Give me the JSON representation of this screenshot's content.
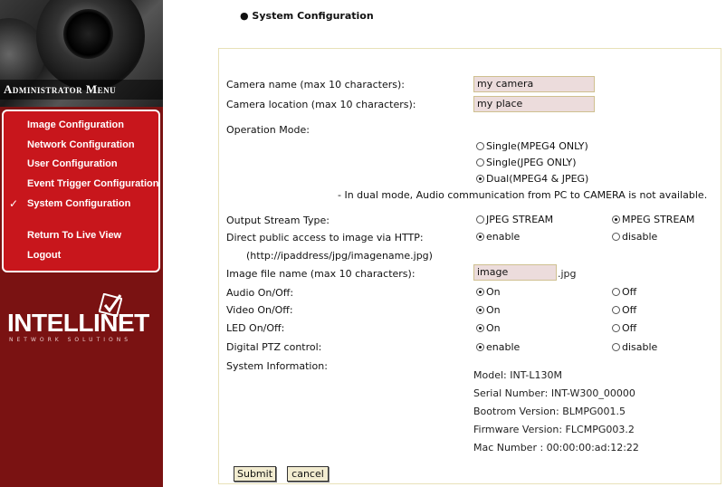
{
  "sidebar": {
    "title": "Administrator Menu",
    "items": [
      {
        "label": "Image Configuration"
      },
      {
        "label": "Network Configuration"
      },
      {
        "label": "User Configuration"
      },
      {
        "label": "Event Trigger Configuration"
      },
      {
        "label": "System Configuration",
        "active": true
      },
      {
        "label": "Return To Live View"
      },
      {
        "label": "Logout"
      }
    ],
    "logo": {
      "brand": "INTELLINET",
      "tagline": "NETWORK SOLUTIONS"
    }
  },
  "page": {
    "heading": "● System Configuration"
  },
  "form": {
    "camera_name": {
      "label": "Camera name (max 10 characters):",
      "value": "my camera"
    },
    "camera_location": {
      "label": "Camera location (max 10 characters):",
      "value": "my place"
    },
    "operation_mode": {
      "label": "Operation Mode:",
      "options": [
        "Single(MPEG4 ONLY)",
        "Single(JPEG ONLY)",
        "Dual(MPEG4 & JPEG)"
      ],
      "selected": "Dual(MPEG4 & JPEG)",
      "note": "- In dual mode, Audio communication from PC to CAMERA is not available."
    },
    "output_stream": {
      "label": "Output Stream Type:",
      "options": [
        "JPEG STREAM",
        "MPEG STREAM"
      ],
      "selected": "MPEG STREAM"
    },
    "http_access": {
      "label": "Direct public access to image via HTTP:",
      "sublabel": "(http://ipaddress/jpg/imagename.jpg)",
      "options": [
        "enable",
        "disable"
      ],
      "selected": "enable"
    },
    "image_file": {
      "label": "Image file name (max 10 characters):",
      "value": "image",
      "suffix": ".jpg"
    },
    "audio": {
      "label": "Audio On/Off:",
      "options": [
        "On",
        "Off"
      ],
      "selected": "On"
    },
    "video": {
      "label": "Video On/Off:",
      "options": [
        "On",
        "Off"
      ],
      "selected": "On"
    },
    "led": {
      "label": "LED On/Off:",
      "options": [
        "On",
        "Off"
      ],
      "selected": "On"
    },
    "ptz": {
      "label": "Digital PTZ control:",
      "options": [
        "enable",
        "disable"
      ],
      "selected": "enable"
    },
    "system_info": {
      "label": "System Information:",
      "lines": [
        "Model: INT-L130M",
        "Serial Number: INT-W300_00000",
        "Bootrom Version: BLMPG001.5",
        "Firmware Version: FLCMPG003.2",
        "Mac Number : 00:00:00:ad:12:22"
      ]
    },
    "buttons": {
      "submit": "Submit",
      "cancel": "cancel"
    }
  }
}
